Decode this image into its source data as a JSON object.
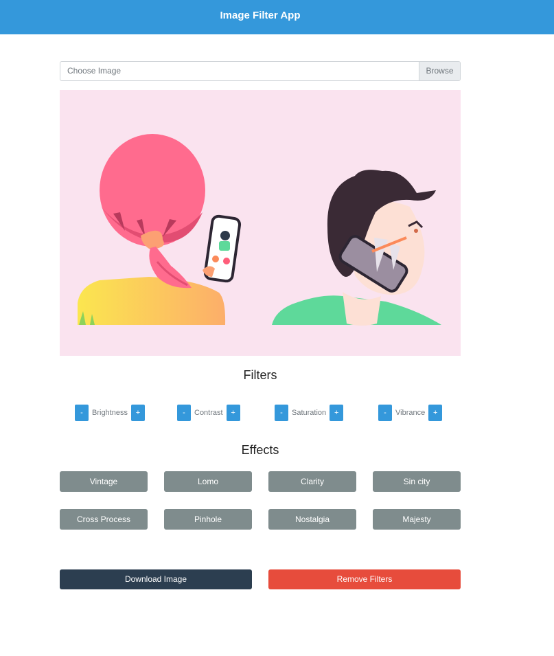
{
  "header": {
    "title": "Image Filter App"
  },
  "file_input": {
    "placeholder": "Choose Image",
    "browse_label": "Browse"
  },
  "filters": {
    "title": "Filters",
    "items": [
      {
        "label": "Brightness",
        "minus": "-",
        "plus": "+"
      },
      {
        "label": "Contrast",
        "minus": "-",
        "plus": "+"
      },
      {
        "label": "Saturation",
        "minus": "-",
        "plus": "+"
      },
      {
        "label": "Vibrance",
        "minus": "-",
        "plus": "+"
      }
    ]
  },
  "effects": {
    "title": "Effects",
    "buttons": [
      "Vintage",
      "Lomo",
      "Clarity",
      "Sin city",
      "Cross Process",
      "Pinhole",
      "Nostalgia",
      "Majesty"
    ]
  },
  "actions": {
    "download": "Download Image",
    "remove": "Remove Filters"
  },
  "colors": {
    "navbar": "#3498db",
    "accent": "#3498db",
    "effect_button": "#7f8c8d",
    "download_button": "#2c3e50",
    "remove_button": "#e74c3c",
    "canvas_background": "#fae3ef"
  }
}
